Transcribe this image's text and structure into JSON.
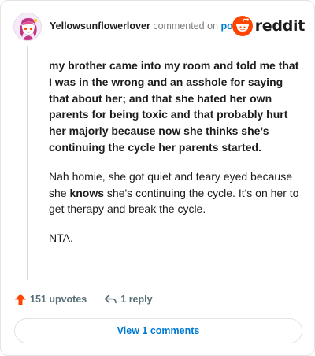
{
  "header": {
    "author": "Yellowsunflowerlover",
    "action_text": "commented on",
    "target_link": "post",
    "brand_name": "reddit"
  },
  "comment": {
    "quote": "my brother came into my room and told me that I was in the wrong and an asshole for saying that about her; and that she hated her own parents for being toxic and that probably hurt her majorly because now she thinks she’s continuing the cycle her parents started.",
    "para1_a": "Nah homie, she got quiet and teary eyed because she ",
    "para1_bold": "knows",
    "para1_b": " she's continuing the cycle. It's on her to get therapy and break the cycle.",
    "para2": "NTA."
  },
  "actions": {
    "upvotes_label": "151 upvotes",
    "reply_label": "1 reply",
    "view_comments_label": "View 1 comments"
  },
  "colors": {
    "upvote": "#ff4500",
    "link": "#0079d3",
    "muted": "#576f76",
    "reddit_orange": "#ff4500"
  },
  "icons": {
    "avatar": "user-avatar",
    "brand": "reddit-logo-icon",
    "upvote": "upvote-arrow-icon",
    "reply": "reply-arrow-icon"
  }
}
